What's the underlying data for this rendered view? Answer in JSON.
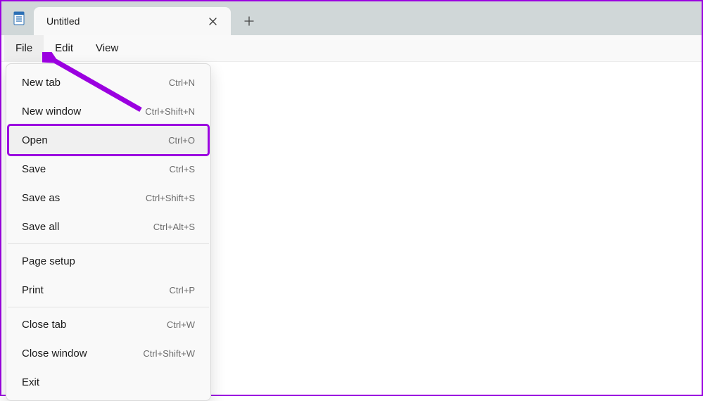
{
  "app": {
    "name": "Notepad"
  },
  "tab": {
    "title": "Untitled"
  },
  "menubar": {
    "file": "File",
    "edit": "Edit",
    "view": "View"
  },
  "file_menu": {
    "items": [
      {
        "label": "New tab",
        "shortcut": "Ctrl+N"
      },
      {
        "label": "New window",
        "shortcut": "Ctrl+Shift+N"
      },
      {
        "label": "Open",
        "shortcut": "Ctrl+O",
        "highlight": true
      },
      {
        "label": "Save",
        "shortcut": "Ctrl+S"
      },
      {
        "label": "Save as",
        "shortcut": "Ctrl+Shift+S"
      },
      {
        "label": "Save all",
        "shortcut": "Ctrl+Alt+S"
      },
      {
        "label": "Page setup",
        "shortcut": ""
      },
      {
        "label": "Print",
        "shortcut": "Ctrl+P"
      },
      {
        "label": "Close tab",
        "shortcut": "Ctrl+W"
      },
      {
        "label": "Close window",
        "shortcut": "Ctrl+Shift+W"
      },
      {
        "label": "Exit",
        "shortcut": ""
      }
    ],
    "separators_after": [
      5,
      7
    ]
  },
  "annotation": {
    "color": "#9b00e0"
  }
}
